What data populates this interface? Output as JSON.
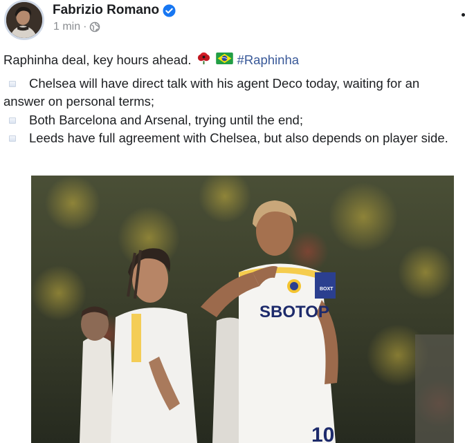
{
  "post": {
    "author": "Fabrizio Romano",
    "timestamp": "1 min",
    "meta_separator": "·",
    "headline": "Raphinha deal, key hours ahead.",
    "hashtag": "#Raphinha",
    "bullets": [
      "Chelsea will have direct talk with his agent Deco today, waiting for an answer on personal terms;",
      "Both Barcelona and Arsenal, trying until the end;",
      "Leeds have full agreement with Chelsea, but also depends on player side."
    ],
    "photo_text": {
      "sponsor": "SBOTOP",
      "shirt_number": "10",
      "sleeve_sponsor": "BOXT"
    }
  },
  "icons": {
    "verified": "verified-badge-icon",
    "audience": "globe-icon",
    "more": "more-options-icon",
    "headline_emoji_1": "poppy-emoji",
    "headline_emoji_2": "brazil-flag-emoji",
    "bullet": "bullet-square-icon"
  },
  "colors": {
    "verified_blue": "#1877f2",
    "hashtag_blue": "#385898",
    "meta_gray": "#8a8d91",
    "text": "#1c1e21"
  }
}
